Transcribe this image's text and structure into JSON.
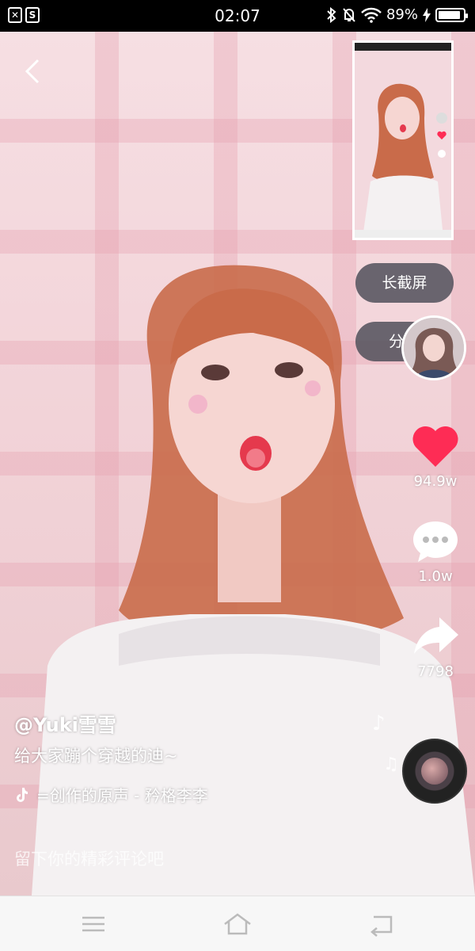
{
  "status_bar": {
    "time": "02:07",
    "battery": "89%",
    "battery_fraction": 0.89,
    "left_icons": [
      "x-icon",
      "s-icon"
    ],
    "right_icons": [
      "bluetooth-icon",
      "mute-icon",
      "wifi-icon",
      "charging-icon"
    ]
  },
  "video": {
    "pills": {
      "long_screenshot": "长截屏",
      "share": "分享"
    },
    "actions": {
      "likes": "94.9w",
      "comments": "1.0w",
      "shares": "7798"
    },
    "author": "@Yuki雪雪",
    "description": "给大家蹦个穿越的迪~",
    "music": "=创作的原声 - 矜格李李",
    "comment_placeholder": "留下你的精彩评论吧"
  },
  "colors": {
    "like_red": "#fe2c55",
    "pill_bg": "#50505a",
    "nav_bg": "#f7f7f7"
  },
  "navbar": {
    "icons": [
      "menu-icon",
      "home-icon",
      "back-icon"
    ]
  }
}
